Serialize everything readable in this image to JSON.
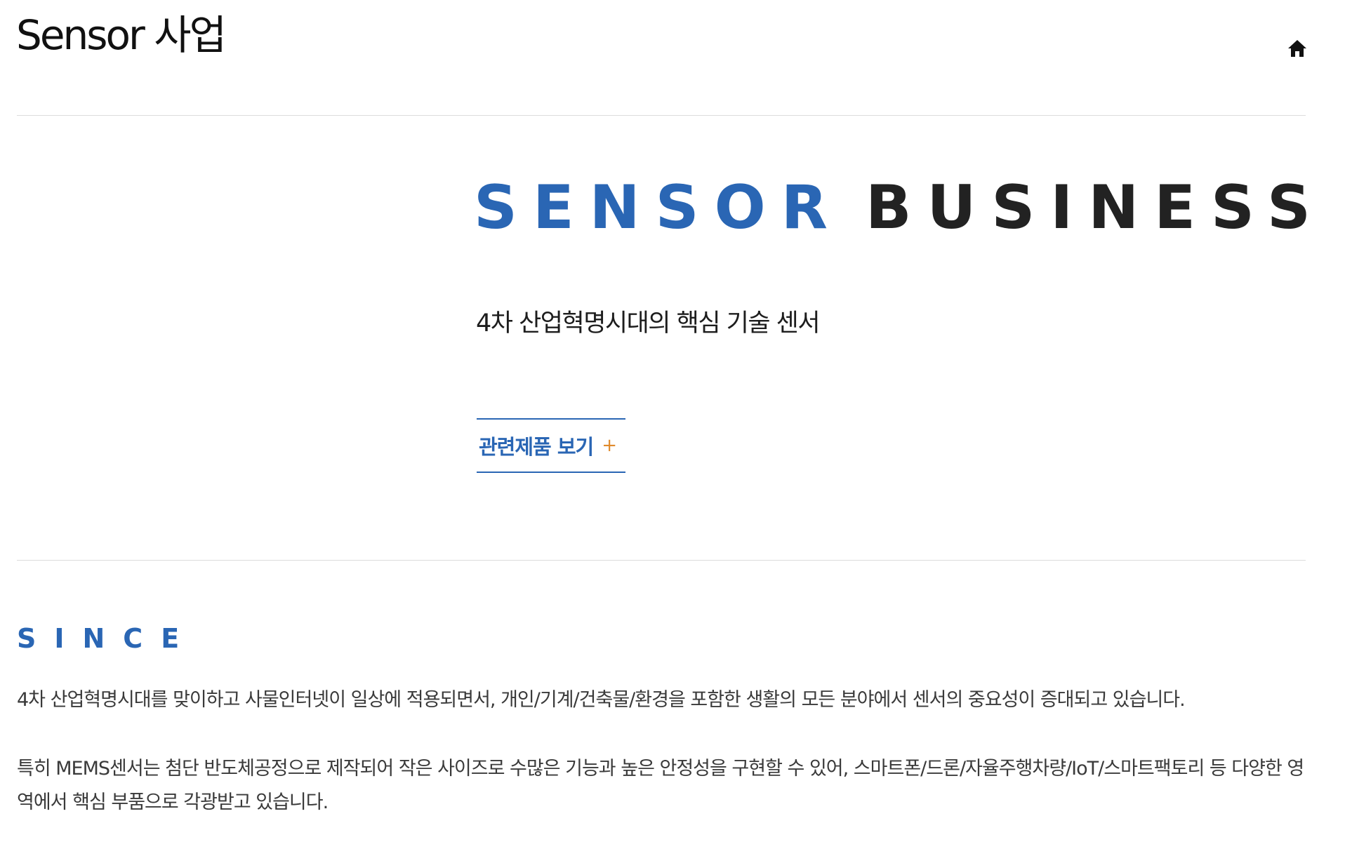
{
  "header": {
    "title": "Sensor 사업",
    "home_icon": "home-icon"
  },
  "hero": {
    "title_part1": "SENSOR",
    "title_part2": "BUSINESS",
    "subtitle": "4차 산업혁명시대의 핵심 기술 센서",
    "products_button_label": "관련제품 보기",
    "products_button_icon": "+"
  },
  "since": {
    "label": "SINCE",
    "paragraph_1": "4차 산업혁명시대를 맞이하고 사물인터넷이 일상에 적용되면서, 개인/기계/건축물/환경을 포함한 생활의 모든 분야에서 센서의 중요성이 증대되고 있습니다.",
    "paragraph_2": "특히 MEMS센서는 첨단 반도체공정으로 제작되어 작은 사이즈로 수많은 기능과 높은 안정성을 구현할 수 있어, 스마트폰/드론/자율주행차량/IoT/스마트팩토리 등 다양한 영역에서 핵심 부품으로 각광받고 있습니다."
  },
  "colors": {
    "accent_blue": "#2a66b4",
    "dark_text": "#222222",
    "plus_orange": "#e08a2c",
    "divider": "#dcdcdc"
  }
}
